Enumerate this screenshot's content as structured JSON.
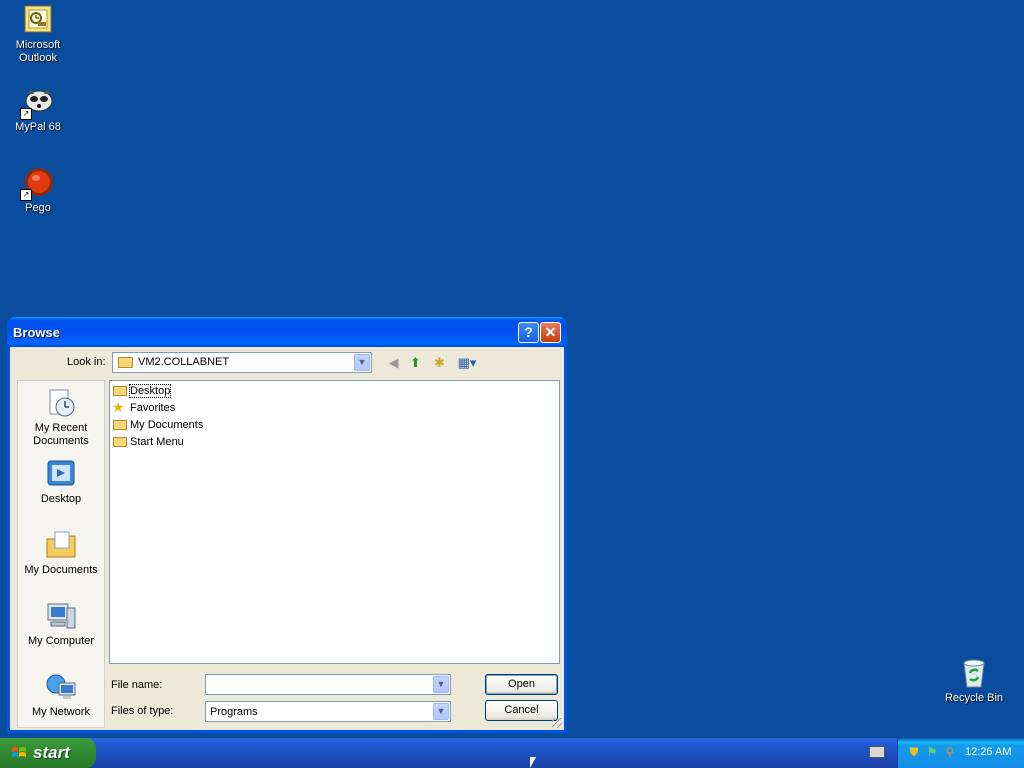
{
  "desktop": {
    "icons": [
      {
        "label_line1": "Microsoft",
        "label_line2": "Outlook",
        "icon": "outlook-icon"
      },
      {
        "label_line1": "MyPal 68",
        "label_line2": "",
        "icon": "mypal-icon"
      },
      {
        "label_line1": "Pego",
        "label_line2": "",
        "icon": "pego-icon"
      },
      {
        "label_line1": "Recycle Bin",
        "label_line2": "",
        "icon": "recycle-bin-icon"
      }
    ]
  },
  "dialog": {
    "title": "Browse",
    "help_glyph": "?",
    "close_glyph": "✕",
    "look_in_label": "Look in:",
    "look_in_value": "VM2.COLLABNET",
    "places": [
      {
        "line1": "My Recent",
        "line2": "Documents",
        "icon": "recent-documents-icon"
      },
      {
        "line1": "Desktop",
        "line2": "",
        "icon": "desktop-icon"
      },
      {
        "line1": "My Documents",
        "line2": "",
        "icon": "my-documents-icon"
      },
      {
        "line1": "My Computer",
        "line2": "",
        "icon": "my-computer-icon"
      },
      {
        "line1": "My Network",
        "line2": "",
        "icon": "my-network-icon"
      }
    ],
    "files": [
      {
        "name": "Desktop",
        "icon": "folder-icon",
        "selected": true
      },
      {
        "name": "Favorites",
        "icon": "star-icon",
        "selected": false
      },
      {
        "name": "My Documents",
        "icon": "folder-icon",
        "selected": false
      },
      {
        "name": "Start Menu",
        "icon": "folder-icon",
        "selected": false
      }
    ],
    "file_name_label": "File name:",
    "file_name_value": "",
    "files_of_type_label": "Files of type:",
    "files_of_type_value": "Programs",
    "open_button": "Open",
    "cancel_button": "Cancel"
  },
  "taskbar": {
    "start_label": "start",
    "clock": "12:26 AM"
  },
  "colors": {
    "desktop_bg": "#0a4d9e",
    "titlebar": "#0053ee",
    "dialog_bg": "#ece9d8",
    "start_green": "#318a31"
  }
}
